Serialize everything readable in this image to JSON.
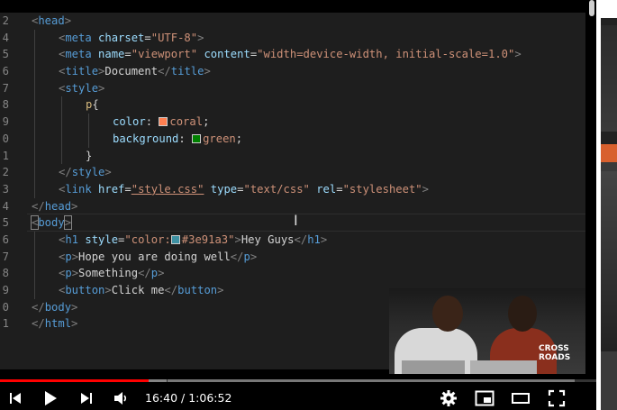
{
  "editor": {
    "lines": [
      {
        "num": "2",
        "tokens": [
          [
            "br",
            "<"
          ],
          [
            "tag",
            "head"
          ],
          [
            "br",
            ">"
          ]
        ],
        "indent": 0
      },
      {
        "num": "4",
        "tokens": [
          [
            "br",
            "<"
          ],
          [
            "tag",
            "meta "
          ],
          [
            "attr",
            "charset"
          ],
          [
            "txt",
            "="
          ],
          [
            "str",
            "\"UTF-8\""
          ],
          [
            "br",
            ">"
          ]
        ],
        "indent": 1
      },
      {
        "num": "5",
        "tokens": [
          [
            "br",
            "<"
          ],
          [
            "tag",
            "meta "
          ],
          [
            "attr",
            "name"
          ],
          [
            "txt",
            "="
          ],
          [
            "str",
            "\"viewport\""
          ],
          [
            "txt",
            " "
          ],
          [
            "attr",
            "content"
          ],
          [
            "txt",
            "="
          ],
          [
            "str",
            "\"width=device-width, initial-scale=1.0\""
          ],
          [
            "br",
            ">"
          ]
        ],
        "indent": 1
      },
      {
        "num": "6",
        "tokens": [
          [
            "br",
            "<"
          ],
          [
            "tag",
            "title"
          ],
          [
            "br",
            ">"
          ],
          [
            "txt",
            "Document"
          ],
          [
            "br",
            "</"
          ],
          [
            "tag",
            "title"
          ],
          [
            "br",
            ">"
          ]
        ],
        "indent": 1
      },
      {
        "num": "7",
        "tokens": [
          [
            "br",
            "<"
          ],
          [
            "tag",
            "style"
          ],
          [
            "br",
            ">"
          ]
        ],
        "indent": 1
      },
      {
        "num": "8",
        "tokens": [
          [
            "sel",
            "p"
          ],
          [
            "txt",
            "{"
          ]
        ],
        "indent": 2
      },
      {
        "num": "9",
        "tokens": [
          [
            "prop",
            "color"
          ],
          [
            "txt",
            ": "
          ],
          [
            "swatch",
            "#ff7f50"
          ],
          [
            "val",
            "coral"
          ],
          [
            "txt",
            ";"
          ]
        ],
        "indent": 3
      },
      {
        "num": "0",
        "tokens": [
          [
            "prop",
            "background"
          ],
          [
            "txt",
            ": "
          ],
          [
            "swatch",
            "#008000"
          ],
          [
            "val",
            "green"
          ],
          [
            "txt",
            ";"
          ]
        ],
        "indent": 3
      },
      {
        "num": "1",
        "tokens": [
          [
            "txt",
            "}"
          ]
        ],
        "indent": 2
      },
      {
        "num": "2",
        "tokens": [
          [
            "br",
            "</"
          ],
          [
            "tag",
            "style"
          ],
          [
            "br",
            ">"
          ]
        ],
        "indent": 1
      },
      {
        "num": "3",
        "tokens": [
          [
            "br",
            "<"
          ],
          [
            "tag",
            "link "
          ],
          [
            "attr",
            "href"
          ],
          [
            "txt",
            "="
          ],
          [
            "strul",
            "\"style.css\""
          ],
          [
            "txt",
            " "
          ],
          [
            "attr",
            "type"
          ],
          [
            "txt",
            "="
          ],
          [
            "str",
            "\"text/css\""
          ],
          [
            "txt",
            " "
          ],
          [
            "attr",
            "rel"
          ],
          [
            "txt",
            "="
          ],
          [
            "str",
            "\"stylesheet\""
          ],
          [
            "br",
            ">"
          ]
        ],
        "indent": 1
      },
      {
        "num": "4",
        "tokens": [
          [
            "br",
            "</"
          ],
          [
            "tag",
            "head"
          ],
          [
            "br",
            ">"
          ]
        ],
        "indent": 0
      },
      {
        "num": "5",
        "tokens": [
          [
            "brbox",
            "<"
          ],
          [
            "tag",
            "body"
          ],
          [
            "brbox",
            ">"
          ]
        ],
        "indent": 0
      },
      {
        "num": "6",
        "tokens": [
          [
            "br",
            "<"
          ],
          [
            "tag",
            "h1 "
          ],
          [
            "attr",
            "style"
          ],
          [
            "txt",
            "="
          ],
          [
            "str",
            "\"color:"
          ],
          [
            "swatch",
            "#3e91a3"
          ],
          [
            "str",
            "#3e91a3\""
          ],
          [
            "br",
            ">"
          ],
          [
            "txt",
            "Hey Guys"
          ],
          [
            "br",
            "</"
          ],
          [
            "tag",
            "h1"
          ],
          [
            "br",
            ">"
          ]
        ],
        "indent": 1
      },
      {
        "num": "7",
        "tokens": [
          [
            "br",
            "<"
          ],
          [
            "tag",
            "p"
          ],
          [
            "br",
            ">"
          ],
          [
            "txt",
            "Hope you are doing well"
          ],
          [
            "br",
            "</"
          ],
          [
            "tag",
            "p"
          ],
          [
            "br",
            ">"
          ]
        ],
        "indent": 1
      },
      {
        "num": "8",
        "tokens": [
          [
            "br",
            "<"
          ],
          [
            "tag",
            "p"
          ],
          [
            "br",
            ">"
          ],
          [
            "txt",
            "Something"
          ],
          [
            "br",
            "</"
          ],
          [
            "tag",
            "p"
          ],
          [
            "br",
            ">"
          ]
        ],
        "indent": 1
      },
      {
        "num": "9",
        "tokens": [
          [
            "br",
            "<"
          ],
          [
            "tag",
            "button"
          ],
          [
            "br",
            ">"
          ],
          [
            "txt",
            "Click me"
          ],
          [
            "br",
            "</"
          ],
          [
            "tag",
            "button"
          ],
          [
            "br",
            ">"
          ]
        ],
        "indent": 1
      },
      {
        "num": "0",
        "tokens": [
          [
            "br",
            "</"
          ],
          [
            "tag",
            "body"
          ],
          [
            "br",
            ">"
          ]
        ],
        "indent": 0
      },
      {
        "num": "1",
        "tokens": [
          [
            "br",
            "</"
          ],
          [
            "tag",
            "html"
          ],
          [
            "br",
            ">"
          ]
        ],
        "indent": 0
      }
    ]
  },
  "webcam": {
    "brand_line1": "CROSS",
    "brand_line2": "ROADS"
  },
  "player": {
    "current_time": "16:40",
    "separator": " / ",
    "duration": "1:06:52",
    "time_display": "16:40 / 1:06:52",
    "progress_fraction": 0.2492,
    "buffer_fraction": 0.28,
    "colors": {
      "played": "#ff0000",
      "background": "#000000"
    },
    "controls": {
      "prev_icon": "skip-previous-icon",
      "play_icon": "play-icon",
      "next_icon": "skip-next-icon",
      "volume_icon": "volume-icon",
      "settings_icon": "gear-icon",
      "miniplayer_icon": "miniplayer-icon",
      "theater_icon": "theater-mode-icon",
      "fullscreen_icon": "fullscreen-icon"
    }
  }
}
